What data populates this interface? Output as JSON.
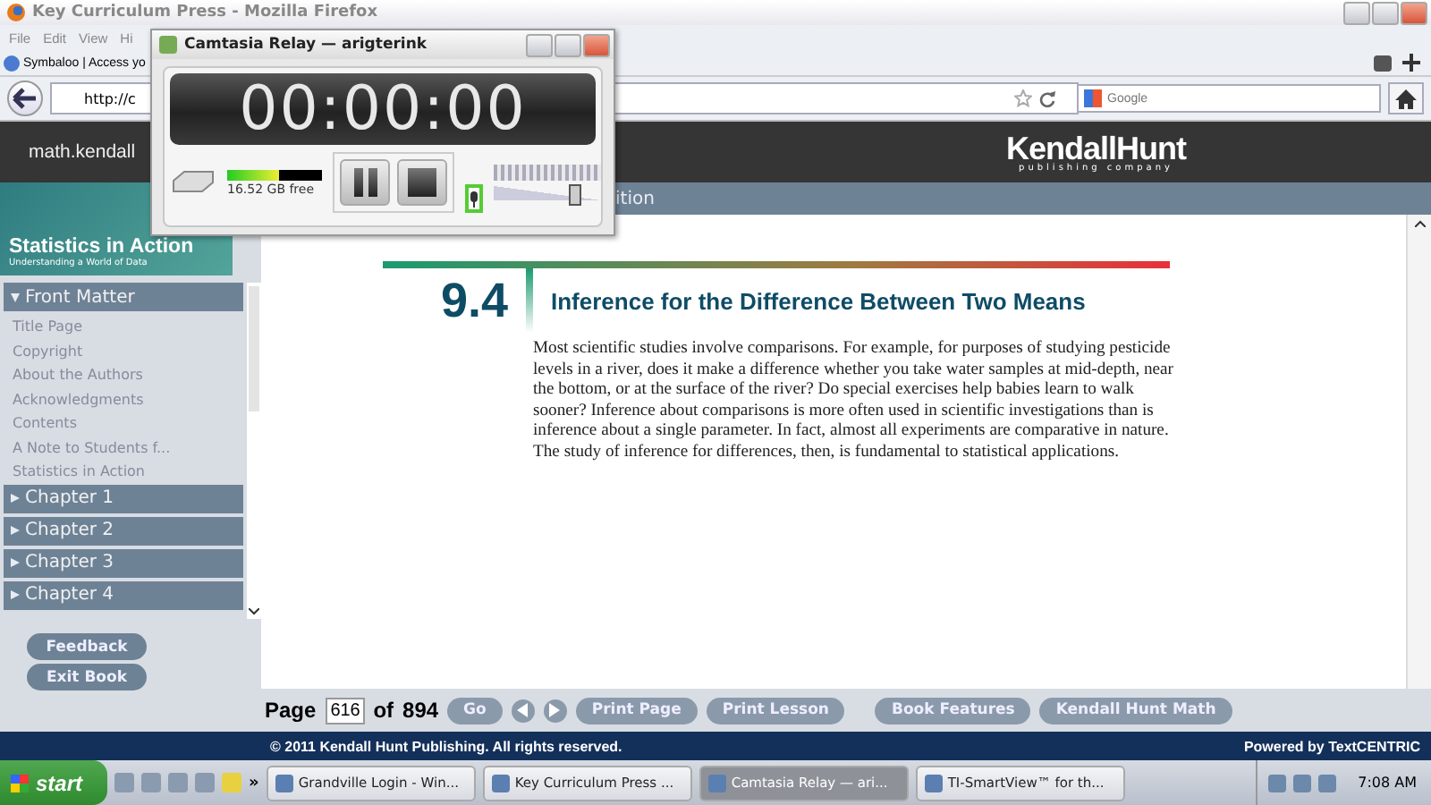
{
  "browser": {
    "title": "Key Curriculum Press - Mozilla Firefox",
    "menu": [
      "File",
      "Edit",
      "View",
      "Hi"
    ],
    "bookmark": "Symbaloo | Access yo",
    "url": "http://c",
    "search": {
      "placeholder": "Google"
    }
  },
  "site": {
    "domain": "math.kendall",
    "logo": {
      "name": "KendallHunt",
      "tagline": "publishing company"
    },
    "subbar": "ition"
  },
  "sidebar": {
    "cover": {
      "title": "Statistics in Action",
      "subtitle": "Understanding a World of Data"
    },
    "sections": [
      {
        "label": "Front Matter",
        "expanded": true,
        "children": [
          {
            "label": "Title Page"
          },
          {
            "label": "Copyright"
          },
          {
            "label": "About the Authors"
          },
          {
            "label": "Acknowledgments"
          },
          {
            "label": "Contents"
          },
          {
            "label": "A Note to Students f..."
          },
          {
            "label": "Statistics in Action"
          }
        ]
      },
      {
        "label": "Chapter 1",
        "expanded": false
      },
      {
        "label": "Chapter 2",
        "expanded": false
      },
      {
        "label": "Chapter 3",
        "expanded": false
      },
      {
        "label": "Chapter 4",
        "expanded": false
      }
    ],
    "buttons": [
      "Feedback",
      "Exit Book"
    ]
  },
  "content": {
    "number": "9.4",
    "heading": "Inference for the Difference Between Two Means",
    "paragraph": "Most scientific studies involve comparisons. For example, for purposes of studying pesticide levels in a river, does it make a difference whether you take water samples at mid-depth, near the bottom, or at the surface of the river? Do special exercises help babies learn to walk sooner? Inference about comparisons is more often used in scientific investigations than is inference about a single parameter. In fact, almost all experiments are comparative in nature. The study of inference for differences, then, is fundamental to statistical applications."
  },
  "pager": {
    "label": "Page",
    "page": "616",
    "of": "of",
    "total": "894",
    "go": "Go",
    "buttons": [
      "Print Page",
      "Print Lesson",
      "Book Features",
      "Kendall Hunt Math"
    ]
  },
  "footer": {
    "copyright": "© 2011 Kendall Hunt Publishing. All rights reserved.",
    "powered": "Powered by TextCENTRIC"
  },
  "taskbar": {
    "start": "start",
    "more": "»",
    "tasks": [
      {
        "label": "Grandville Login - Win...",
        "selected": false
      },
      {
        "label": "Key Curriculum Press ...",
        "selected": false
      },
      {
        "label": "Camtasia Relay — ari...",
        "selected": true
      },
      {
        "label": "TI-SmartView™ for th...",
        "selected": false
      }
    ],
    "clock": "7:08 AM"
  },
  "recorder": {
    "title": "Camtasia Relay — arigterink",
    "timer": "00:00:00",
    "disk": {
      "level": 0.55,
      "free": "16.52 GB free"
    },
    "volume": {
      "level": 0.75
    }
  }
}
